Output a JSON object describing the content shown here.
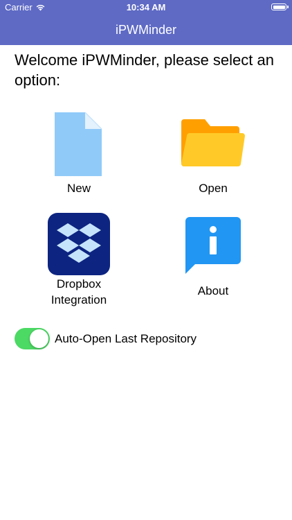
{
  "status_bar": {
    "carrier": "Carrier",
    "time": "10:34 AM",
    "wifi_icon": "wifi-icon",
    "battery_icon": "battery-icon"
  },
  "nav": {
    "title": "iPWMinder",
    "background_color": "#5e6ac4"
  },
  "welcome_text": "Welcome iPWMinder, please select an option:",
  "options": {
    "new": {
      "label": "New",
      "icon": "new-document-icon"
    },
    "open": {
      "label": "Open",
      "icon": "folder-icon"
    },
    "dropbox": {
      "label_line1": "Dropbox",
      "label_line2": "Integration",
      "icon": "dropbox-icon",
      "color": "#0d2481"
    },
    "about": {
      "label": "About",
      "icon": "info-icon",
      "color": "#2196f3"
    }
  },
  "auto_open": {
    "label": "Auto-Open Last Repository",
    "enabled": true,
    "color": "#4cd964"
  }
}
